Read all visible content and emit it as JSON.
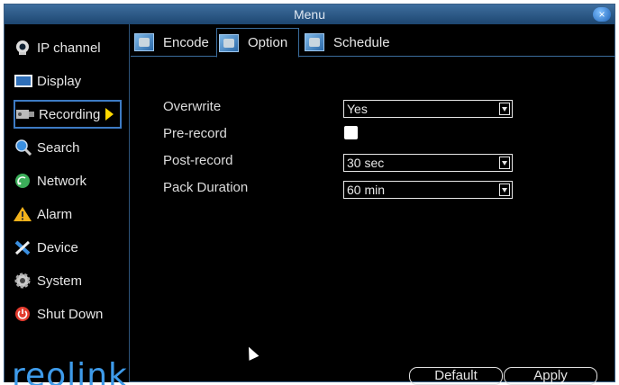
{
  "window": {
    "title": "Menu",
    "close_glyph": "×"
  },
  "sidebar": {
    "items": [
      {
        "label": "IP channel",
        "icon": "ip-camera-icon"
      },
      {
        "label": "Display",
        "icon": "display-icon"
      },
      {
        "label": "Recording",
        "icon": "recording-icon",
        "active": true
      },
      {
        "label": "Search",
        "icon": "search-icon"
      },
      {
        "label": "Network",
        "icon": "network-icon"
      },
      {
        "label": "Alarm",
        "icon": "alarm-icon"
      },
      {
        "label": "Device",
        "icon": "device-icon"
      },
      {
        "label": "System",
        "icon": "system-icon"
      },
      {
        "label": "Shut Down",
        "icon": "power-icon"
      }
    ],
    "logo_text": "reolink"
  },
  "tabs": [
    {
      "label": "Encode"
    },
    {
      "label": "Option",
      "active": true
    },
    {
      "label": "Schedule"
    }
  ],
  "form": {
    "overwrite": {
      "label": "Overwrite",
      "value": "Yes"
    },
    "prerecord": {
      "label": "Pre-record",
      "checked": true
    },
    "postrecord": {
      "label": "Post-record",
      "value": "30 sec"
    },
    "pack_duration": {
      "label": "Pack Duration",
      "value": "60 min"
    }
  },
  "buttons": {
    "default_label": "Default",
    "apply_label": "Apply"
  },
  "colors": {
    "accent": "#3d7bc4",
    "warning": "#ffd800",
    "logo": "#3e9bea"
  }
}
